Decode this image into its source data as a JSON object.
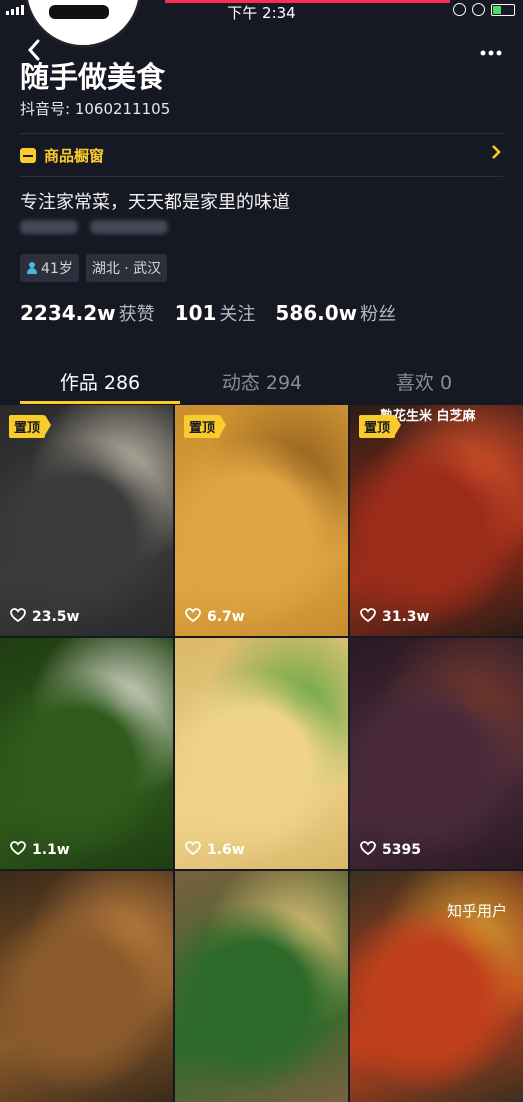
{
  "status": {
    "time": "下午 2:34"
  },
  "profile": {
    "name": "随手做美食",
    "douyin_id": "抖音号: 1060211105",
    "shop_label": "商品橱窗",
    "bio": "专注家常菜，天天都是家里的味道",
    "tags": [
      "41岁",
      "湖北 · 武汉"
    ],
    "stats": [
      {
        "value": "2234.2w",
        "label": "获赞"
      },
      {
        "value": "101",
        "label": "关注"
      },
      {
        "value": "586.0w",
        "label": "粉丝"
      }
    ]
  },
  "tabs": [
    {
      "label": "作品 286"
    },
    {
      "label": "动态 294"
    },
    {
      "label": "喜欢 0"
    }
  ],
  "videos": [
    {
      "pinned_label": "置顶",
      "likes": "23.5w",
      "colors": [
        "#2a2a2a",
        "#3b3b3b",
        "#c9c1b0"
      ]
    },
    {
      "pinned_label": "置顶",
      "likes": "6.7w",
      "colors": [
        "#c98d2d",
        "#e0a543",
        "#8a5a1a"
      ]
    },
    {
      "pinned_label": "置顶",
      "likes": "31.3w",
      "overlay_text": "熟花生米 白芝麻",
      "colors": [
        "#2b1d16",
        "#9c2c1a",
        "#d9532b"
      ]
    },
    {
      "likes": "1.1w",
      "colors": [
        "#1f3d12",
        "#2f5a1c",
        "#e8e4dc"
      ]
    },
    {
      "likes": "1.6w",
      "colors": [
        "#d9b86a",
        "#f0d38a",
        "#5aa33c"
      ]
    },
    {
      "likes": "5395",
      "colors": [
        "#2a1a24",
        "#4a2a3a",
        "#7a3a2a"
      ]
    },
    {
      "colors": [
        "#3a2a1a",
        "#8a5a2a",
        "#c08040"
      ]
    },
    {
      "colors": [
        "#7a6040",
        "#2d6a2a",
        "#e9c97a"
      ]
    },
    {
      "colors": [
        "#3a3020",
        "#c0401c",
        "#d9a030"
      ]
    }
  ],
  "watermark": "知乎用户"
}
